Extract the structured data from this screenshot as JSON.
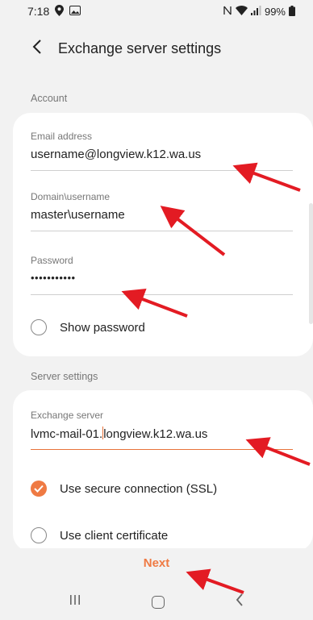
{
  "status_bar": {
    "time": "7:18",
    "battery_percent": "99%",
    "left_icons": [
      "location-icon",
      "gallery-icon"
    ],
    "right_icons": [
      "nfc-icon",
      "wifi-icon",
      "signal-icon",
      "battery-icon"
    ]
  },
  "header": {
    "title": "Exchange server settings"
  },
  "account": {
    "section_label": "Account",
    "email": {
      "label": "Email address",
      "value": "username@longview.k12.wa.us"
    },
    "domain_username": {
      "label": "Domain\\username",
      "value": "master\\username"
    },
    "password": {
      "label": "Password",
      "value": "•••••••••••"
    },
    "show_password": {
      "label": "Show password",
      "checked": false
    }
  },
  "server": {
    "section_label": "Server settings",
    "exchange_server": {
      "label": "Exchange server",
      "value_before_cursor": "lvmc-mail-01.",
      "value_after_cursor": "longview.k12.wa.us"
    },
    "secure_connection": {
      "label": "Use secure connection (SSL)",
      "checked": true
    },
    "client_certificate": {
      "label": "Use client certificate",
      "checked": false
    }
  },
  "footer": {
    "next_label": "Next"
  },
  "colors": {
    "accent": "#ef7a43",
    "annotation_arrow": "#e31b23",
    "background": "#f2f2f2",
    "card": "#ffffff"
  }
}
